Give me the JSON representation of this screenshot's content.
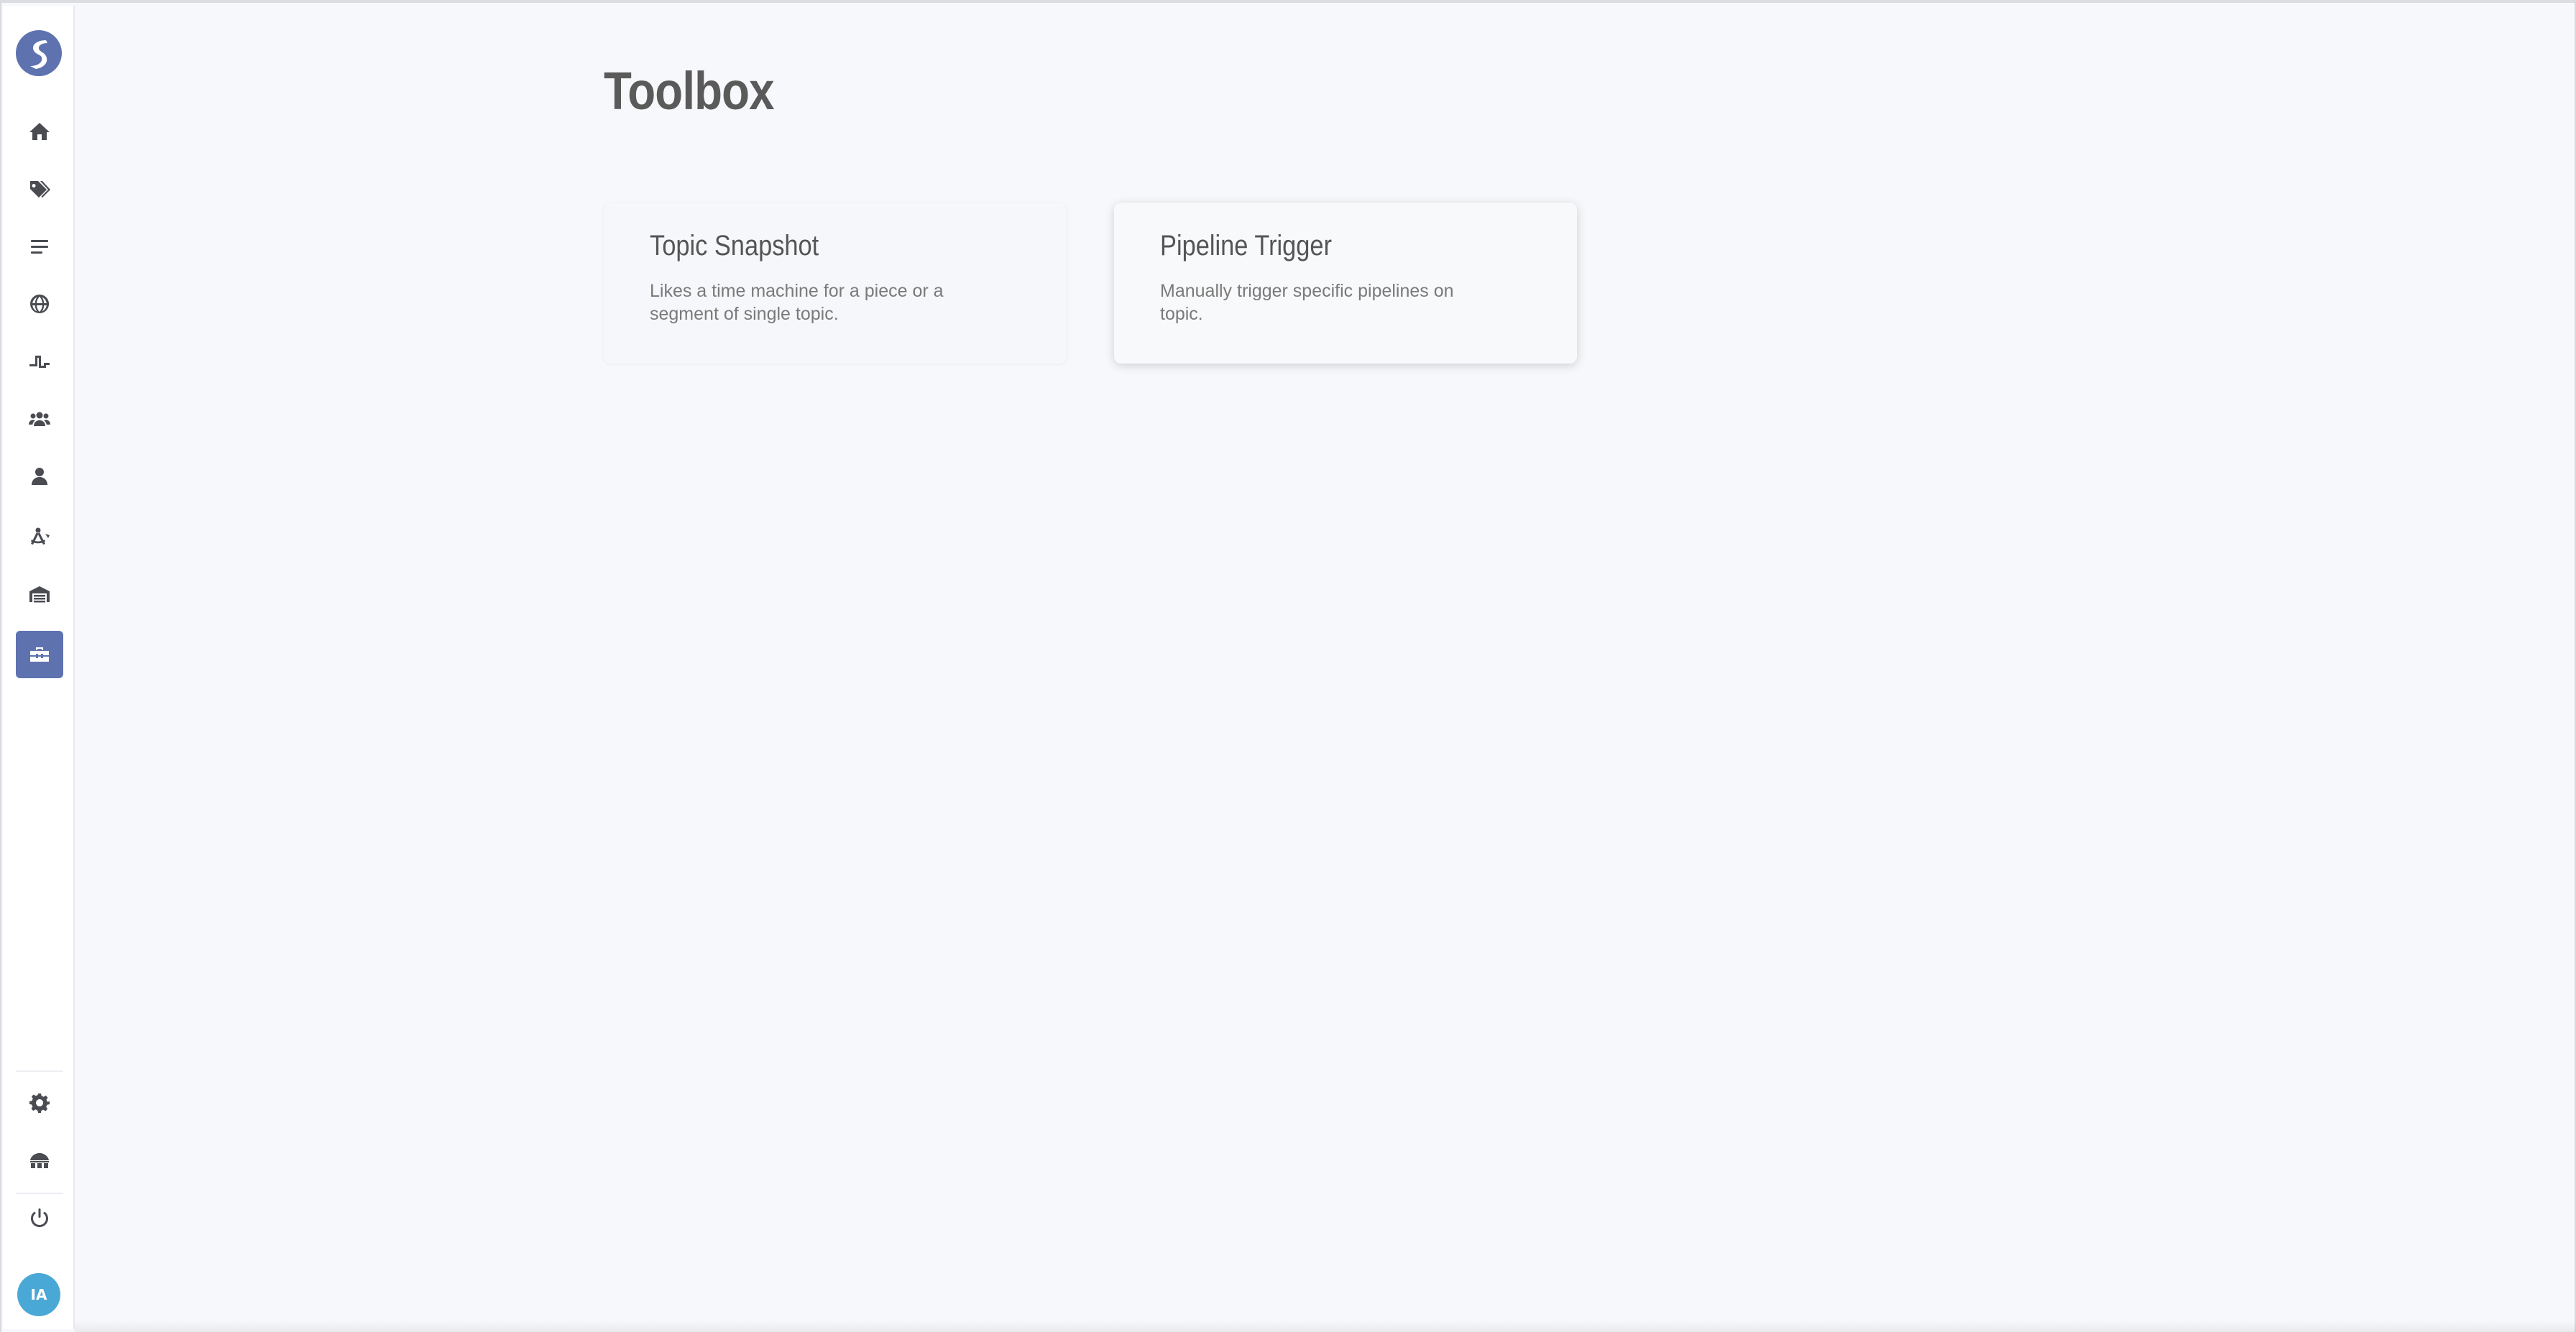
{
  "page": {
    "title": "Toolbox"
  },
  "sidebar": {
    "logo_icon": "snowflake-s-logo",
    "items": [
      {
        "icon": "home-icon"
      },
      {
        "icon": "tags-icon"
      },
      {
        "icon": "list-icon"
      },
      {
        "icon": "globe-icon"
      },
      {
        "icon": "pulse-icon"
      },
      {
        "icon": "users-icon"
      },
      {
        "icon": "user-icon"
      },
      {
        "icon": "compass-drafting-icon"
      },
      {
        "icon": "warehouse-icon"
      },
      {
        "icon": "toolbox-icon",
        "active": true
      }
    ],
    "bottom_items": [
      {
        "icon": "gear-icon"
      },
      {
        "icon": "network-icon"
      },
      {
        "icon": "power-icon"
      }
    ],
    "avatar_initials": "IA"
  },
  "cards": [
    {
      "title": "Topic Snapshot",
      "description": "Likes a time machine for a piece or a segment of single topic."
    },
    {
      "title": "Pipeline Trigger",
      "description": "Manually trigger specific pipelines on topic."
    }
  ],
  "colors": {
    "accent": "#5e72b0",
    "background": "#f7f8fb",
    "avatar": "#4aa8d6"
  }
}
